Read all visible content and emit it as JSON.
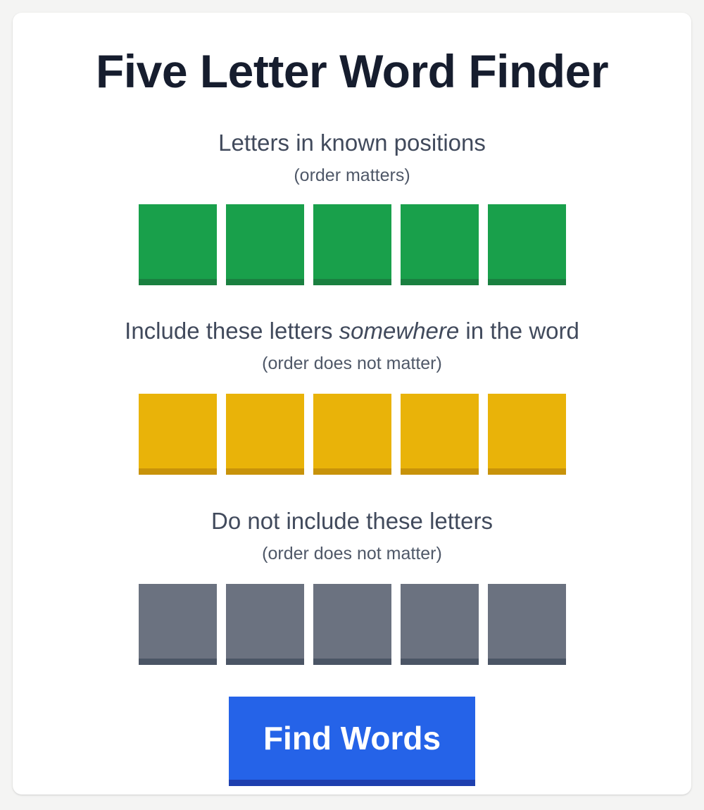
{
  "app": {
    "title": "Five Letter Word Finder",
    "background_color": "#f4f4f3",
    "card_color": "#ffffff",
    "title_color": "#161d2e"
  },
  "sections": {
    "known": {
      "heading_before": "Letters in known positions",
      "heading_em": "",
      "heading_after": "",
      "subtitle": "(order matters)",
      "accent_color": "#19a04b",
      "accent_border_color": "#1a8040",
      "tiles": [
        {
          "value": "",
          "placeholder": ""
        },
        {
          "value": "",
          "placeholder": ""
        },
        {
          "value": "",
          "placeholder": ""
        },
        {
          "value": "",
          "placeholder": ""
        },
        {
          "value": "",
          "placeholder": ""
        }
      ]
    },
    "include": {
      "heading_before": "Include these letters ",
      "heading_em": "somewhere",
      "heading_after": " in the word",
      "subtitle": "(order does not matter)",
      "accent_color": "#e9b309",
      "accent_border_color": "#c8930a",
      "tiles": [
        {
          "value": "",
          "placeholder": ""
        },
        {
          "value": "",
          "placeholder": ""
        },
        {
          "value": "",
          "placeholder": ""
        },
        {
          "value": "",
          "placeholder": ""
        },
        {
          "value": "",
          "placeholder": ""
        }
      ]
    },
    "exclude": {
      "heading_before": "Do not include these letters",
      "heading_em": "",
      "heading_after": "",
      "subtitle": "(order does not matter)",
      "accent_color": "#6b7280",
      "accent_border_color": "#4b5565",
      "tiles": [
        {
          "value": "",
          "placeholder": ""
        },
        {
          "value": "",
          "placeholder": ""
        },
        {
          "value": "",
          "placeholder": ""
        },
        {
          "value": "",
          "placeholder": ""
        },
        {
          "value": "",
          "placeholder": ""
        }
      ]
    }
  },
  "actions": {
    "find_words_label": "Find Words",
    "find_words_color": "#2563e8",
    "find_words_border_color": "#1e40af"
  }
}
